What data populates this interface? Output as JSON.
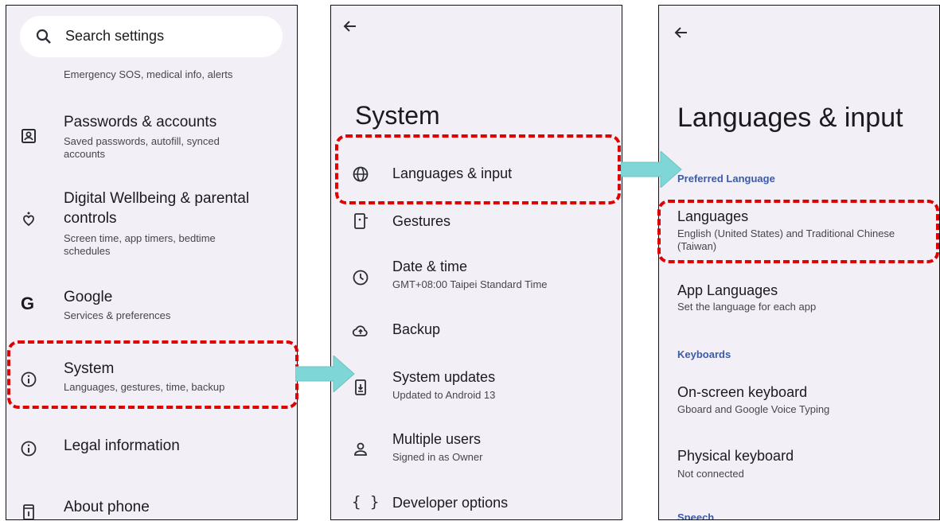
{
  "panel1": {
    "search_placeholder": "Search settings",
    "safety_sub": "Emergency SOS, medical info, alerts",
    "items": [
      {
        "title": "Passwords & accounts",
        "sub": "Saved passwords, autofill, synced accounts",
        "icon": "account-box-icon"
      },
      {
        "title": "Digital Wellbeing & parental controls",
        "sub": "Screen time, app timers, bedtime schedules",
        "icon": "wellbeing-icon"
      },
      {
        "title": "Google",
        "sub": "Services & preferences",
        "icon": "google-icon"
      },
      {
        "title": "System",
        "sub": "Languages, gestures, time, backup",
        "icon": "info-icon"
      },
      {
        "title": "Legal information",
        "sub": "",
        "icon": "info-icon"
      },
      {
        "title": "About phone",
        "sub": "",
        "icon": "phone-icon"
      }
    ]
  },
  "panel2": {
    "title": "System",
    "items": [
      {
        "title": "Languages & input",
        "sub": "",
        "icon": "globe-icon"
      },
      {
        "title": "Gestures",
        "sub": "",
        "icon": "gesture-phone-icon"
      },
      {
        "title": "Date & time",
        "sub": "GMT+08:00 Taipei Standard Time",
        "icon": "clock-icon"
      },
      {
        "title": "Backup",
        "sub": "",
        "icon": "cloud-upload-icon"
      },
      {
        "title": "System updates",
        "sub": "Updated to Android 13",
        "icon": "system-update-icon"
      },
      {
        "title": "Multiple users",
        "sub": "Signed in as Owner",
        "icon": "person-icon"
      },
      {
        "title": "Developer options",
        "sub": "",
        "icon": "braces-icon"
      }
    ]
  },
  "panel3": {
    "title": "Languages & input",
    "section_preferred": "Preferred Language",
    "languages_title": "Languages",
    "languages_sub": "English (United States) and Traditional Chinese (Taiwan)",
    "app_languages_title": "App Languages",
    "app_languages_sub": "Set the language for each app",
    "section_keyboards": "Keyboards",
    "onscreen_title": "On-screen keyboard",
    "onscreen_sub": "Gboard and Google Voice Typing",
    "physical_title": "Physical keyboard",
    "physical_sub": "Not connected",
    "section_speech": "Speech"
  },
  "colors": {
    "panel_bg": "#f3eff6",
    "highlight": "#e00000",
    "arrow": "#7fd6d6",
    "section_text": "#3b5ba9"
  }
}
